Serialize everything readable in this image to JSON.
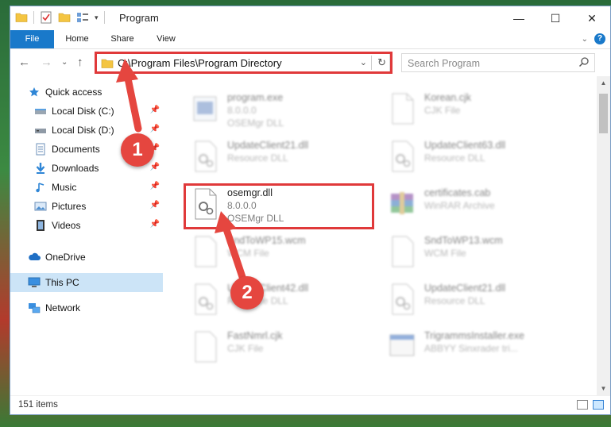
{
  "window": {
    "title": "Program",
    "controls": {
      "minimize": "—",
      "maximize": "☐",
      "close": "✕"
    }
  },
  "ribbon": {
    "tabs": [
      "File",
      "Home",
      "Share",
      "View"
    ],
    "help": "?"
  },
  "address": {
    "path": "C:\\Program Files\\Program Directory"
  },
  "search": {
    "placeholder": "Search Program"
  },
  "nav": {
    "items": [
      {
        "label": "Quick access",
        "icon": "star-icon",
        "pinned": false
      },
      {
        "label": "Local Disk (C:)",
        "icon": "drive-icon",
        "pinned": true
      },
      {
        "label": "Local Disk (D:)",
        "icon": "drive-icon",
        "pinned": true
      },
      {
        "label": "Documents",
        "icon": "documents-icon",
        "pinned": true
      },
      {
        "label": "Downloads",
        "icon": "download-icon",
        "pinned": true
      },
      {
        "label": "Music",
        "icon": "music-icon",
        "pinned": true
      },
      {
        "label": "Pictures",
        "icon": "pictures-icon",
        "pinned": true
      },
      {
        "label": "Videos",
        "icon": "videos-icon",
        "pinned": true
      },
      {
        "label": "OneDrive",
        "icon": "cloud-icon",
        "pinned": false
      },
      {
        "label": "This PC",
        "icon": "computer-icon",
        "pinned": false
      },
      {
        "label": "Network",
        "icon": "network-icon",
        "pinned": false
      }
    ]
  },
  "files": [
    {
      "name": "program.exe",
      "line2": "8.0.0.0",
      "line3": "OSEMgr DLL",
      "type": "exe"
    },
    {
      "name": "Korean.cjk",
      "line2": "CJK File",
      "line3": "",
      "type": "doc"
    },
    {
      "name": "UpdateClient21.dll",
      "line2": "Resource DLL",
      "line3": "",
      "type": "dll"
    },
    {
      "name": "UpdateClient63.dll",
      "line2": "Resource DLL",
      "line3": "",
      "type": "dll"
    },
    {
      "name": "osemgr.dll",
      "line2": "8.0.0.0",
      "line3": "OSEMgr DLL",
      "type": "dll"
    },
    {
      "name": "certificates.cab",
      "line2": "WinRAR Archive",
      "line3": "",
      "type": "rar"
    },
    {
      "name": "SndToWP15.wcm",
      "line2": "WCM File",
      "line3": "",
      "type": "doc"
    },
    {
      "name": "SndToWP13.wcm",
      "line2": "WCM File",
      "line3": "",
      "type": "doc"
    },
    {
      "name": "UpdateClient42.dll",
      "line2": "Resource DLL",
      "line3": "",
      "type": "dll"
    },
    {
      "name": "UpdateClient21.dll",
      "line2": "Resource DLL",
      "line3": "",
      "type": "dll"
    },
    {
      "name": "FastNmrl.cjk",
      "line2": "CJK File",
      "line3": "",
      "type": "doc"
    },
    {
      "name": "TrigrammsInstaller.exe",
      "line2": "ABBYY Sinxrader tri...",
      "line3": "",
      "type": "installer"
    }
  ],
  "status": {
    "count": "151 items"
  },
  "callouts": {
    "step1": "1",
    "step2": "2"
  },
  "colors": {
    "accent": "#1979ca",
    "highlight": "#e0393a",
    "selected": "#cce4f7"
  }
}
